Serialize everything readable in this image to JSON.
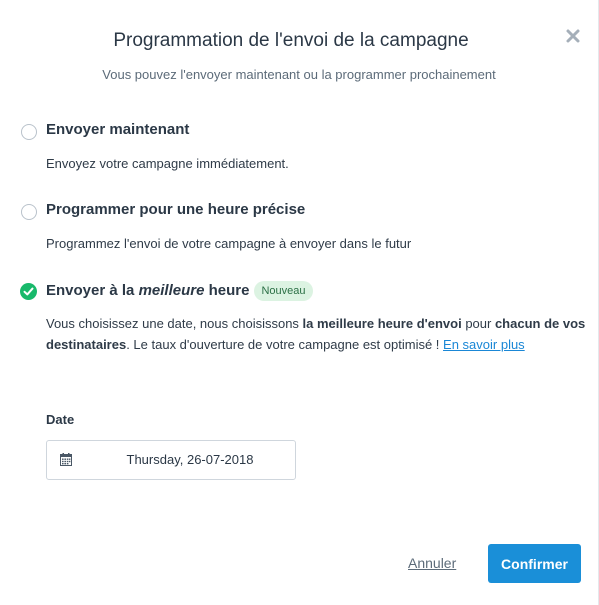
{
  "dialog": {
    "title": "Programmation de l'envoi de la campagne",
    "subtitle": "Vous pouvez l'envoyer maintenant ou la programmer prochainement",
    "close_icon": "close-icon"
  },
  "options": [
    {
      "title": "Envoyer maintenant",
      "description": "Envoyez votre campagne immédiatement.",
      "selected": false
    },
    {
      "title": "Programmer pour une heure précise",
      "description": "Programmez l'envoi de votre campagne à envoyer dans le futur",
      "selected": false
    },
    {
      "title_part1": "Envoyer à la ",
      "title_emphasis": "meilleure",
      "title_part2": " heure",
      "badge": "Nouveau",
      "desc_part1": "Vous choisissez une date, nous choisissons ",
      "desc_bold1": "la meilleure heure d'envoi",
      "desc_part2": " pour ",
      "desc_bold2": "chacun de vos destinataires",
      "desc_part3": ". Le taux d'ouverture de votre campagne est optimisé ! ",
      "desc_link": "En savoir plus",
      "selected": true
    }
  ],
  "date": {
    "label": "Date",
    "value": "Thursday, 26-07-2018",
    "icon": "calendar-icon"
  },
  "footer": {
    "cancel_label": "Annuler",
    "confirm_label": "Confirmer"
  },
  "colors": {
    "accent": "#1a8fd8",
    "success": "#18b96b",
    "badge_bg": "#dcf3e2",
    "link": "#1a87d6"
  }
}
